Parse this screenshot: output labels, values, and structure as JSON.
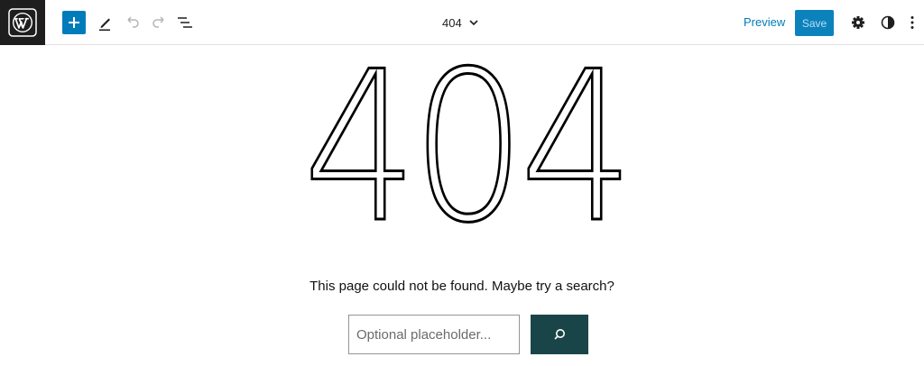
{
  "toolbar": {
    "document_title": "404",
    "preview_label": "Preview",
    "save_label": "Save"
  },
  "content": {
    "heading": "404",
    "message": "This page could not be found. Maybe try a search?",
    "search": {
      "placeholder": "Optional placeholder..."
    }
  },
  "colors": {
    "accent": "#007cba",
    "logo_bg": "#1e1e1e",
    "search_button": "#1a4548"
  },
  "icons": {
    "logo": "wordpress-logo-icon",
    "add": "plus-icon",
    "tools": "pencil-icon",
    "undo": "undo-icon",
    "redo": "redo-icon",
    "list_view": "list-view-icon",
    "title_dropdown": "chevron-down-icon",
    "settings": "gear-icon",
    "styles": "half-circle-icon",
    "options": "more-vertical-icon",
    "search": "search-icon"
  }
}
